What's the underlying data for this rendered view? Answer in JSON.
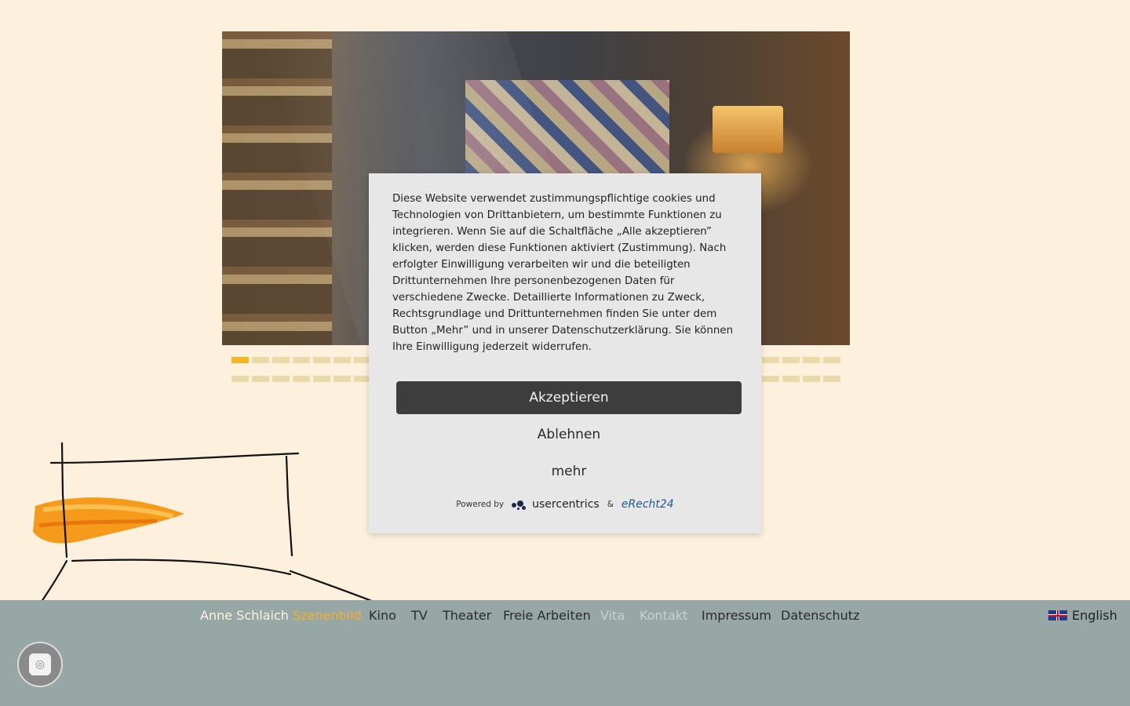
{
  "slider": {
    "active_index": 0,
    "row1_count": 30,
    "row2_count": 30
  },
  "footer": {
    "brand_name": "Anne Schlaich",
    "brand_accent": "Szenenbild",
    "nav": [
      {
        "label": "Kino"
      },
      {
        "label": "TV"
      },
      {
        "label": "Theater"
      },
      {
        "label": "Freie Arbeiten"
      },
      {
        "label": "Vita"
      },
      {
        "label": "Kontakt"
      },
      {
        "label": "Impressum"
      },
      {
        "label": "Datenschutz"
      }
    ],
    "language": "English"
  },
  "consent": {
    "text": "Diese Website verwendet zustimmungspflichtige cookies und Technologien von Drittanbietern, um bestimmte Funktionen zu integrieren. Wenn Sie auf die Schaltfläche „Alle akzeptieren” klicken, werden diese Funktionen aktiviert (Zustimmung). Nach erfolgter Einwilligung verarbeiten wir und die beteiligten Drittunternehmen Ihre personenbezogenen Daten für verschiedene Zwecke. Detaillierte Informationen zu Zweck, Rechtsgrundlage und Drittunternehmen finden Sie unter dem Button „Mehr” und in unserer Datenschutzerklärung. Sie können Ihre Einwilligung jederzeit widerrufen.",
    "accept_label": "Akzeptieren",
    "decline_label": "Ablehnen",
    "more_label": "mehr",
    "powered_by": "Powered by",
    "provider1": "usercentrics",
    "ampersand": "&",
    "provider2": "eRecht24"
  },
  "colors": {
    "page_bg": "#fdf1de",
    "footer_bg": "#96a7a5",
    "accent": "#f3b02c",
    "dot_inactive": "#ecd9a9",
    "dot_active": "#f4b521"
  }
}
